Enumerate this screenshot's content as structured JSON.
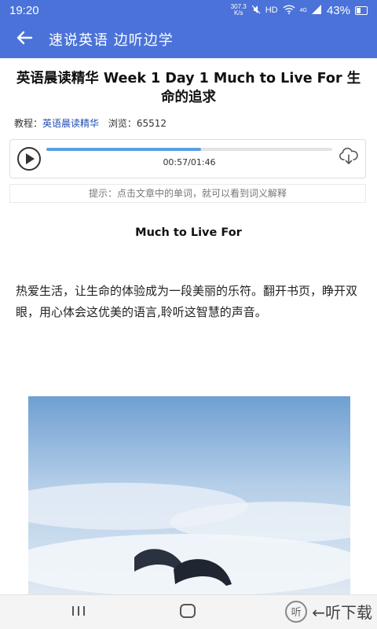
{
  "status_bar": {
    "time": "19:20",
    "net_speed_value": "307.3",
    "net_speed_unit": "K/s",
    "hd_label": "HD",
    "network_label": "4G",
    "battery_percent": "43%"
  },
  "app_bar": {
    "title": "速说英语 边听边学"
  },
  "article": {
    "title": "英语晨读精华 Week 1 Day 1 Much to Live For 生命的追求",
    "meta": {
      "course_label": "教程：",
      "course_link": "英语晨读精华",
      "views_label": "浏览：",
      "views_count": "65512"
    },
    "section_heading": "Much to Live For",
    "paragraph": "热爱生活，让生命的体验成为一段美丽的乐符。翻开书页，睁开双眼，用心体会这优美的语言,聆听这智慧的声音。"
  },
  "audio": {
    "current_time": "00:57",
    "separator": "/",
    "total_time": "01:46",
    "progress_fraction": 0.54
  },
  "hint": {
    "text": "提示：点击文章中的单词，就可以看到词义解释"
  },
  "watermark": {
    "logo_char": "听",
    "text": "←听下载"
  },
  "colors": {
    "primary": "#4a72d9",
    "link": "#1f4bb3",
    "progress": "#5aa0e2"
  }
}
